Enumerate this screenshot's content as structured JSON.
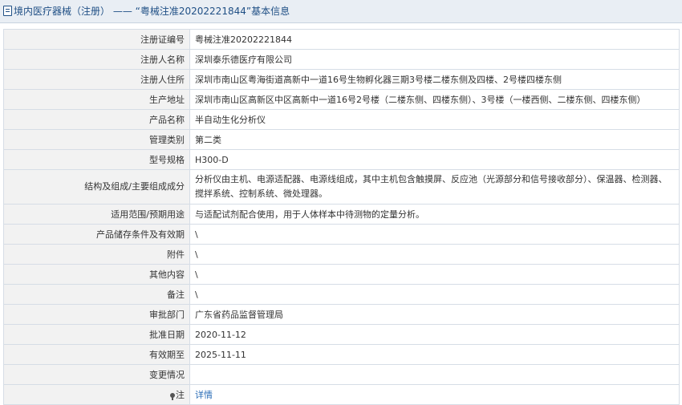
{
  "header": {
    "category": "境内医疗器械（注册）",
    "separator": " —— ",
    "title": "“粤械注准20202221844”基本信息"
  },
  "rows": [
    {
      "label": "注册证编号",
      "value": "粤械注准20202221844"
    },
    {
      "label": "注册人名称",
      "value": "深圳泰乐德医疗有限公司"
    },
    {
      "label": "注册人住所",
      "value": "深圳市南山区粤海街道高新中一道16号生物孵化器三期3号楼二楼东侧及四楼、2号楼四楼东侧"
    },
    {
      "label": "生产地址",
      "value": "深圳市南山区高新区中区高新中一道16号2号楼（二楼东侧、四楼东侧）、3号楼（一楼西侧、二楼东侧、四楼东侧）"
    },
    {
      "label": "产品名称",
      "value": "半自动生化分析仪"
    },
    {
      "label": "管理类别",
      "value": "第二类"
    },
    {
      "label": "型号规格",
      "value": "H300-D"
    },
    {
      "label": "结构及组成/主要组成成分",
      "value": "分析仪由主机、电源适配器、电源线组成，其中主机包含触摸屏、反应池（光源部分和信号接收部分）、保温器、检测器、搅拌系统、控制系统、微处理器。"
    },
    {
      "label": "适用范围/预期用途",
      "value": "与适配试剂配合使用，用于人体样本中待测物的定量分析。"
    },
    {
      "label": "产品储存条件及有效期",
      "value": "\\"
    },
    {
      "label": "附件",
      "value": "\\"
    },
    {
      "label": "其他内容",
      "value": "\\"
    },
    {
      "label": "备注",
      "value": "\\"
    },
    {
      "label": "审批部门",
      "value": "广东省药品监督管理局"
    },
    {
      "label": "批准日期",
      "value": "2020-11-12"
    },
    {
      "label": "有效期至",
      "value": "2025-11-11"
    },
    {
      "label": "变更情况",
      "value": ""
    }
  ],
  "note_row": {
    "label": "注",
    "link": "详情"
  }
}
